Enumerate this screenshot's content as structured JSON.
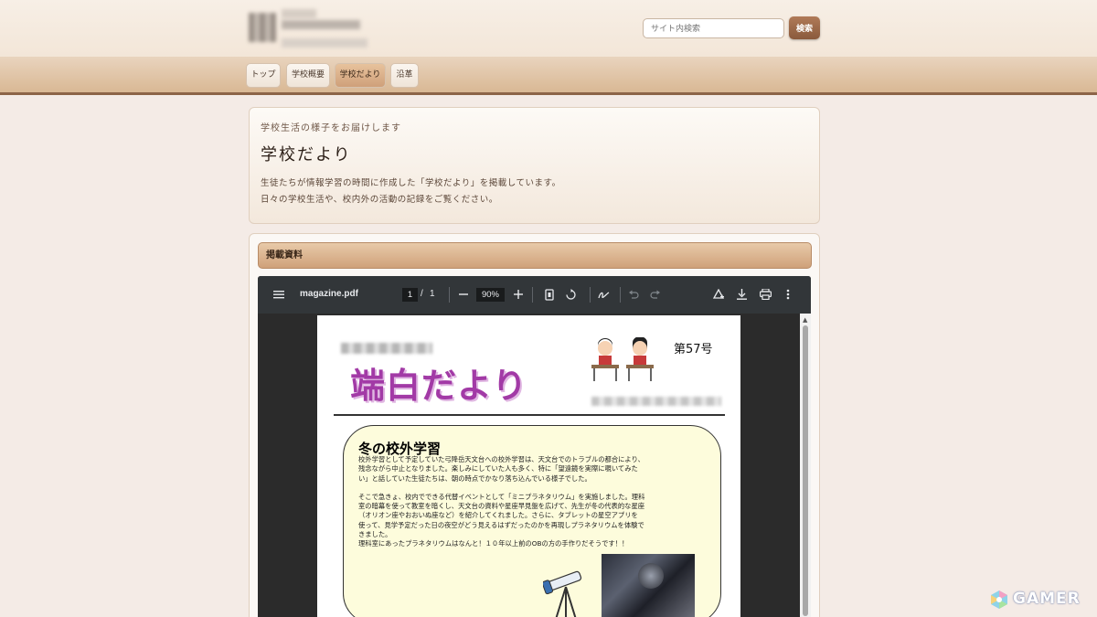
{
  "header": {
    "search_placeholder": "サイト内検索",
    "search_button": "検索"
  },
  "nav": {
    "items": [
      {
        "label": "トップ",
        "active": false
      },
      {
        "label": "学校概要",
        "active": false
      },
      {
        "label": "学校だより",
        "active": true
      },
      {
        "label": "沿革",
        "active": false
      }
    ]
  },
  "intro": {
    "eyebrow": "学校生活の様子をお届けします",
    "title": "学校だより",
    "description_line1": "生徒たちが情報学習の時間に作成した「学校だより」を掲載しています。",
    "description_line2": "日々の学校生活や、校内外の活動の記録をご覧ください。"
  },
  "documents": {
    "heading": "掲載資料"
  },
  "pdf_viewer": {
    "filename": "magazine.pdf",
    "page_current": "1",
    "page_separator": "/",
    "page_total": "1",
    "zoom": "90%",
    "icons": [
      "menu-icon",
      "zoom-out-icon",
      "zoom-in-icon",
      "fit-page-icon",
      "rotate-icon",
      "annotate-icon",
      "undo-icon",
      "redo-icon",
      "add-drive-icon",
      "download-icon",
      "print-icon",
      "more-options-icon"
    ]
  },
  "newsletter": {
    "issue": "第57号",
    "title": "端白だより",
    "article_title": "冬の校外学習",
    "article_paragraph1": "校外学習として予定していた弓降岳天文台への校外学習は、天文台でのトラブルの都合により、\n残念ながら中止となりました。楽しみにしていた人も多く、特に「望遠鏡を実際に覗いてみた\nい」と話していた生徒たちは、朝の時点でかなり落ち込んでいる様子でした。",
    "article_paragraph2": "そこで急きょ、校内でできる代替イベントとして「ミニプラネタリウム」を実施しました。理科\n室の暗幕を使って教室を暗くし、天文台の資料や星座早見盤を広げて、先生が冬の代表的な星座\n（オリオン座やおおいぬ座など）を紹介してくれました。さらに、タブレットの星空アプリを\n使って、見学予定だった日の夜空がどう見えるはずだったのかを再現しプラネタリウムを体験で\nきました。\n理科室にあったプラネタリウムはなんと！１０年以上前のOBの方の手作りだそうです！！"
  },
  "watermark": {
    "brand": "GAMER"
  }
}
